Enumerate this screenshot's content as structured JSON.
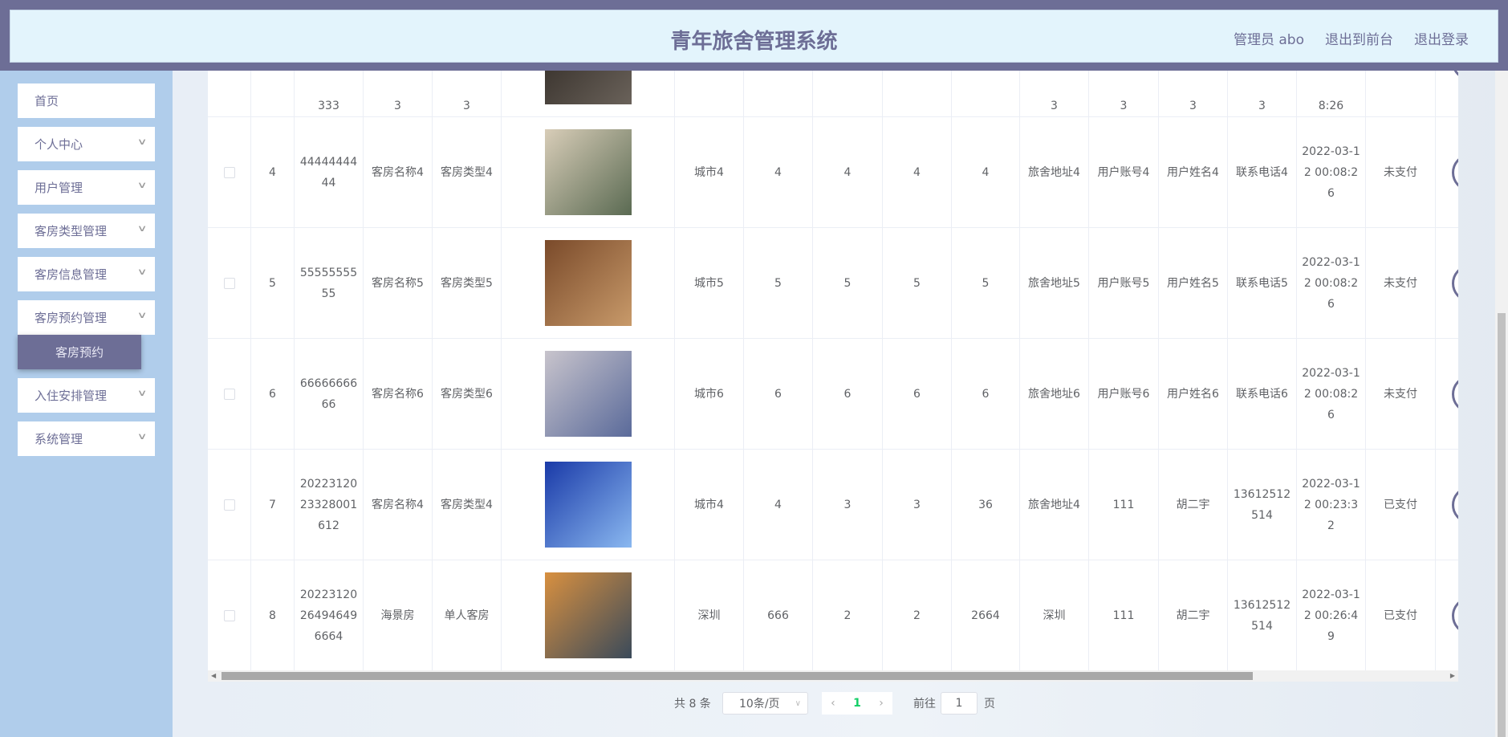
{
  "header": {
    "title": "青年旅舍管理系统",
    "admin": "管理员 abo",
    "back_front": "退出到前台",
    "logout": "退出登录"
  },
  "sidebar": {
    "items": [
      {
        "label": "首页",
        "chevron": false
      },
      {
        "label": "个人中心",
        "chevron": true
      },
      {
        "label": "用户管理",
        "chevron": true
      },
      {
        "label": "客房类型管理",
        "chevron": true
      },
      {
        "label": "客房信息管理",
        "chevron": true
      },
      {
        "label": "客房预约管理",
        "chevron": true
      },
      {
        "label": "入住安排管理",
        "chevron": true
      },
      {
        "label": "系统管理",
        "chevron": true
      }
    ],
    "active_sub": "客房预约"
  },
  "table": {
    "rows": [
      {
        "index": "",
        "order_no": "333",
        "room_name": "3",
        "room_type": "3",
        "image_colors": [
          "#2b2520",
          "#6a625a"
        ],
        "city": "",
        "price": "",
        "count": "",
        "days": "",
        "total": "",
        "address": "3",
        "account": "3",
        "user_name": "3",
        "phone": "3",
        "time": "8:26",
        "status": ""
      },
      {
        "index": "4",
        "order_no": "4444444444",
        "room_name": "客房名称4",
        "room_type": "客房类型4",
        "image_colors": [
          "#d8cdb8",
          "#5a6a52"
        ],
        "city": "城市4",
        "price": "4",
        "count": "4",
        "days": "4",
        "total": "4",
        "address": "旅舍地址4",
        "account": "用户账号4",
        "user_name": "用户姓名4",
        "phone": "联系电话4",
        "time": "2022-03-12 00:08:26",
        "status": "未支付"
      },
      {
        "index": "5",
        "order_no": "5555555555",
        "room_name": "客房名称5",
        "room_type": "客房类型5",
        "image_colors": [
          "#7a4a2a",
          "#c89a6a"
        ],
        "city": "城市5",
        "price": "5",
        "count": "5",
        "days": "5",
        "total": "5",
        "address": "旅舍地址5",
        "account": "用户账号5",
        "user_name": "用户姓名5",
        "phone": "联系电话5",
        "time": "2022-03-12 00:08:26",
        "status": "未支付"
      },
      {
        "index": "6",
        "order_no": "6666666666",
        "room_name": "客房名称6",
        "room_type": "客房类型6",
        "image_colors": [
          "#c8c4cc",
          "#5a6a9a"
        ],
        "city": "城市6",
        "price": "6",
        "count": "6",
        "days": "6",
        "total": "6",
        "address": "旅舍地址6",
        "account": "用户账号6",
        "user_name": "用户姓名6",
        "phone": "联系电话6",
        "time": "2022-03-12 00:08:26",
        "status": "未支付"
      },
      {
        "index": "7",
        "order_no": "2022312023328001612",
        "room_name": "客房名称4",
        "room_type": "客房类型4",
        "image_colors": [
          "#1a3aa8",
          "#8ab8f0"
        ],
        "city": "城市4",
        "price": "4",
        "count": "3",
        "days": "3",
        "total": "36",
        "address": "旅舍地址4",
        "account": "111",
        "user_name": "胡二宇",
        "phone": "13612512514",
        "time": "2022-03-12 00:23:32",
        "status": "已支付"
      },
      {
        "index": "8",
        "order_no": "2022312026494649 6664",
        "room_name": "海景房",
        "room_type": "单人客房",
        "image_colors": [
          "#d89040",
          "#3a4a5a"
        ],
        "city": "深圳",
        "price": "666",
        "count": "2",
        "days": "2",
        "total": "2664",
        "address": "深圳",
        "account": "111",
        "user_name": "胡二宇",
        "phone": "13612512514",
        "time": "2022-03-12 00:26:49",
        "status": "已支付"
      }
    ]
  },
  "pagination": {
    "total": "共 8 条",
    "page_size": "10条/页",
    "current": "1",
    "goto_label": "前往",
    "goto_value": "1",
    "page_suffix": "页",
    "active_color": "#13ce66"
  }
}
